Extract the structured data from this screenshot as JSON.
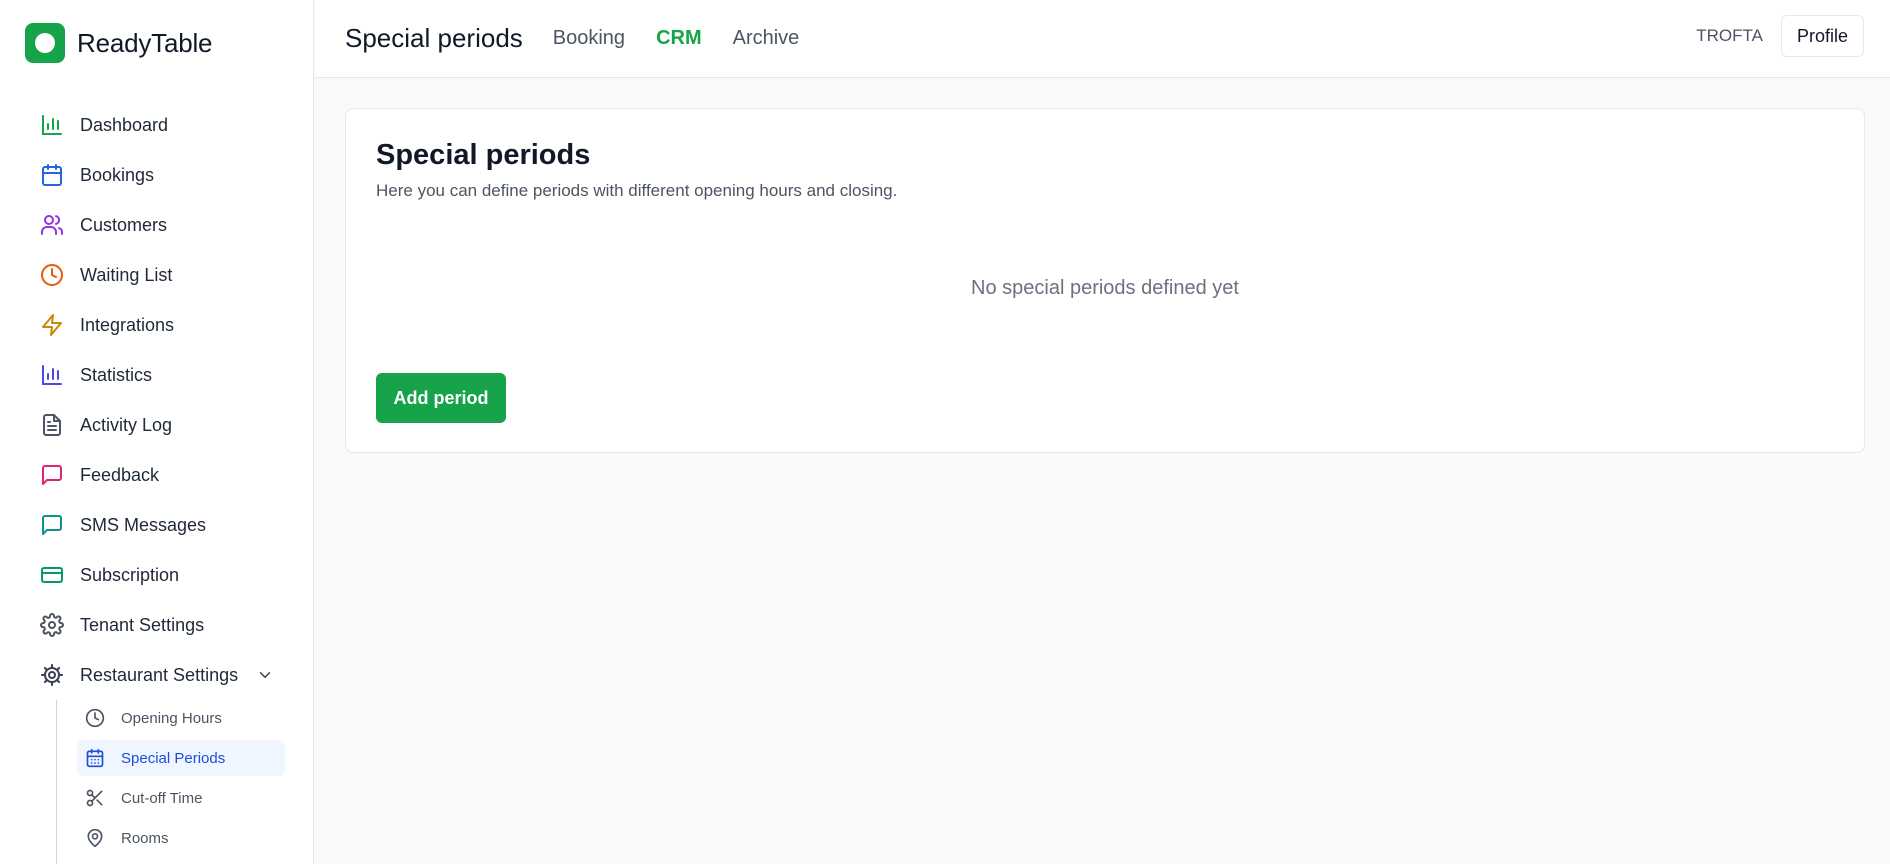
{
  "brand": {
    "name": "ReadyTable",
    "color": "#16a34a"
  },
  "sidebar": {
    "items": [
      {
        "label": "Dashboard",
        "icon": "bar-chart-icon",
        "color": "#16a34a"
      },
      {
        "label": "Bookings",
        "icon": "calendar-icon",
        "color": "#2563eb"
      },
      {
        "label": "Customers",
        "icon": "users-icon",
        "color": "#9333ea"
      },
      {
        "label": "Waiting List",
        "icon": "clock-icon",
        "color": "#ea580c"
      },
      {
        "label": "Integrations",
        "icon": "lightning-icon",
        "color": "#ca8a04"
      },
      {
        "label": "Statistics",
        "icon": "bar-chart-icon",
        "color": "#4f46e5"
      },
      {
        "label": "Activity Log",
        "icon": "document-icon",
        "color": "#4b5563"
      },
      {
        "label": "Feedback",
        "icon": "message-square-icon",
        "color": "#db2777"
      },
      {
        "label": "SMS Messages",
        "icon": "message-square-icon",
        "color": "#0d9488"
      },
      {
        "label": "Subscription",
        "icon": "credit-card-icon",
        "color": "#059669"
      },
      {
        "label": "Tenant Settings",
        "icon": "gear-icon",
        "color": "#4b5563"
      },
      {
        "label": "Restaurant Settings",
        "icon": "cog-icon",
        "color": "#374151",
        "expanded": true
      }
    ],
    "subitems": [
      {
        "label": "Opening Hours",
        "icon": "clock-icon",
        "active": false
      },
      {
        "label": "Special Periods",
        "icon": "calendar-icon",
        "active": true
      },
      {
        "label": "Cut-off Time",
        "icon": "scissors-icon",
        "active": false
      },
      {
        "label": "Rooms",
        "icon": "map-pin-icon",
        "active": false
      }
    ]
  },
  "header": {
    "title": "Special periods",
    "tabs": [
      {
        "label": "Booking",
        "active": false
      },
      {
        "label": "CRM",
        "active": true
      },
      {
        "label": "Archive",
        "active": false
      }
    ],
    "tenant": "TROFTA",
    "profile_label": "Profile"
  },
  "main": {
    "card_title": "Special periods",
    "card_description": "Here you can define periods with different opening hours and closing.",
    "empty_text": "No special periods defined yet",
    "add_label": "Add period",
    "accent": "#16a34a"
  }
}
